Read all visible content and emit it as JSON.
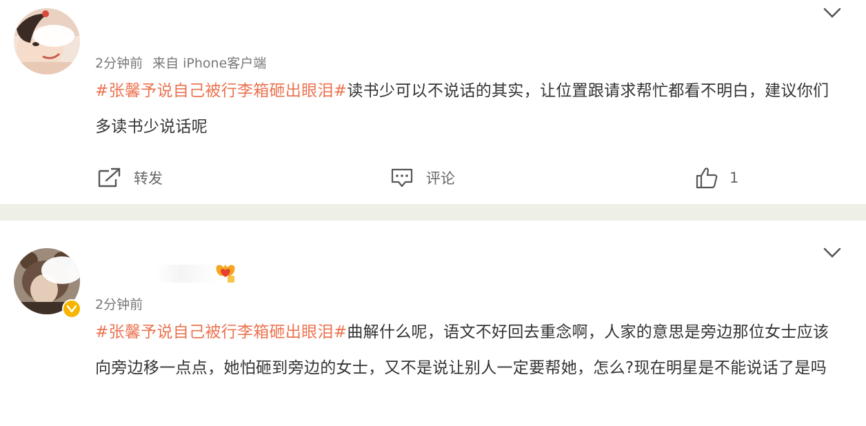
{
  "post1": {
    "meta": {
      "time": "2分钟前",
      "source": "来自 iPhone客户端"
    },
    "topic": "#张馨予说自己被行李箱砸出眼泪#",
    "text": "读书少可以不说话的其实，让位置跟请求帮忙都看不明白，建议你们多读书少说话呢",
    "actions": {
      "repost_label": "转发",
      "comment_label": "评论",
      "like_count": "1"
    }
  },
  "post2": {
    "meta": {
      "time": "2分钟前"
    },
    "topic": "#张馨予说自己被行李箱砸出眼泪#",
    "text": "曲解什么呢，语文不好回去重念啊，人家的意思是旁边那位女士应该向旁边移一点点，她怕砸到旁边的女士，又不是说让别人一定要帮她，怎么?现在明星是不能说话了是吗"
  },
  "colors": {
    "topic": "#eb7350",
    "separator": "#eef0e6",
    "verify": "#f7b500"
  },
  "icons": [
    "chevron-down-icon",
    "repost-icon",
    "comment-icon",
    "like-icon",
    "verified-badge-icon",
    "medal-icon"
  ]
}
